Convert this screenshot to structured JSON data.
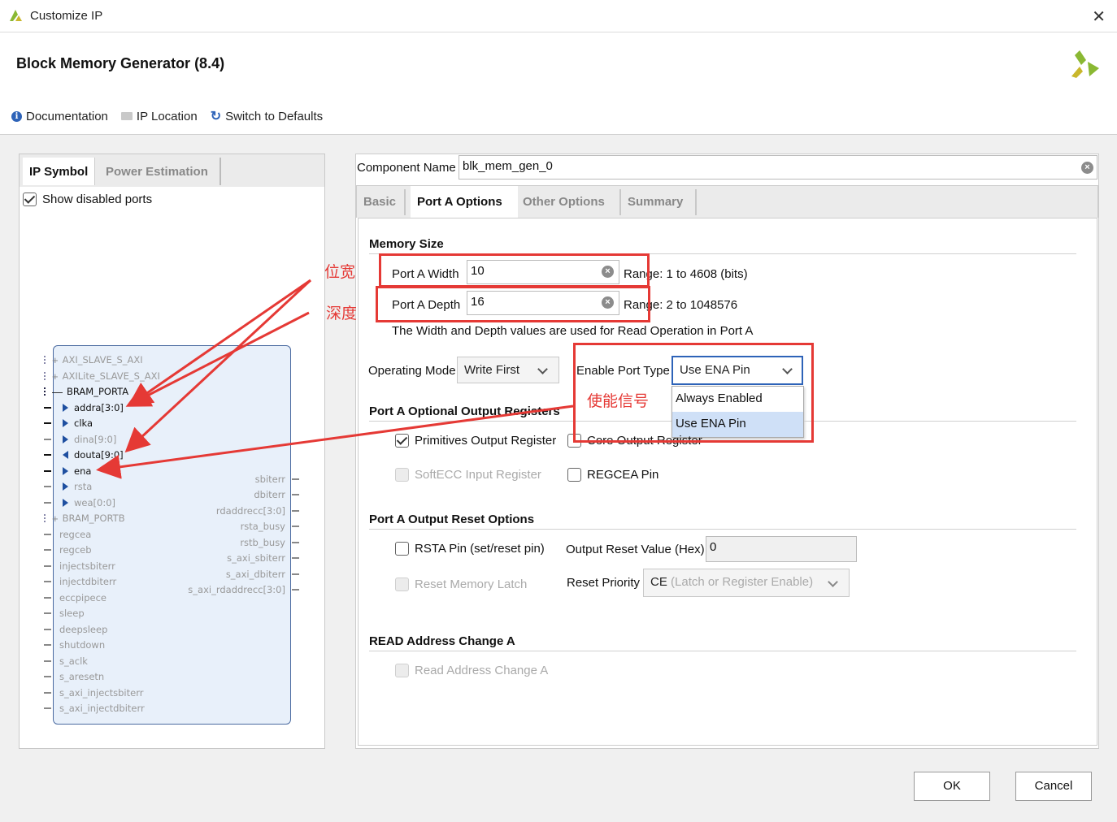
{
  "window": {
    "title": "Customize IP",
    "close": "✕"
  },
  "header": {
    "title": "Block Memory Generator (8.4)"
  },
  "toolbar": {
    "documentation": "Documentation",
    "ip_location": "IP Location",
    "switch_defaults": "Switch to Defaults"
  },
  "left": {
    "tabs": [
      "IP Symbol",
      "Power Estimation"
    ],
    "show_disabled_ports": "Show disabled ports",
    "show_disabled_checked": true,
    "ports_left": [
      {
        "name": "AXI_SLAVE_S_AXI",
        "active": false
      },
      {
        "name": "AXILite_SLAVE_S_AXI",
        "active": false
      },
      {
        "name": "BRAM_PORTA",
        "active": true
      },
      {
        "name": "addra[3:0]",
        "active": true
      },
      {
        "name": "clka",
        "active": true
      },
      {
        "name": "dina[9:0]",
        "active": false
      },
      {
        "name": "douta[9:0]",
        "active": true
      },
      {
        "name": "ena",
        "active": true
      },
      {
        "name": "rsta",
        "active": false
      },
      {
        "name": "wea[0:0]",
        "active": false
      },
      {
        "name": "BRAM_PORTB",
        "active": false
      },
      {
        "name": "regcea",
        "active": false
      },
      {
        "name": "regceb",
        "active": false
      },
      {
        "name": "injectsbiterr",
        "active": false
      },
      {
        "name": "injectdbiterr",
        "active": false
      },
      {
        "name": "eccpipece",
        "active": false
      },
      {
        "name": "sleep",
        "active": false
      },
      {
        "name": "deepsleep",
        "active": false
      },
      {
        "name": "shutdown",
        "active": false
      },
      {
        "name": "s_aclk",
        "active": false
      },
      {
        "name": "s_aresetn",
        "active": false
      },
      {
        "name": "s_axi_injectsbiterr",
        "active": false
      },
      {
        "name": "s_axi_injectdbiterr",
        "active": false
      }
    ],
    "ports_right": [
      "sbiterr",
      "dbiterr",
      "rdaddrecc[3:0]",
      "rsta_busy",
      "rstb_busy",
      "s_axi_sbiterr",
      "s_axi_dbiterr",
      "s_axi_rdaddrecc[3:0]"
    ]
  },
  "right": {
    "component_name_label": "Component Name",
    "component_name": "blk_mem_gen_0",
    "tabs": [
      "Basic",
      "Port A Options",
      "Other Options",
      "Summary"
    ],
    "active_tab": "Port A Options",
    "memory_size": {
      "header": "Memory Size",
      "width_label": "Port A Width",
      "width_value": "10",
      "width_range": "Range: 1 to 4608 (bits)",
      "depth_label": "Port A Depth",
      "depth_value": "16",
      "depth_range": "Range: 2 to 1048576",
      "note": "The Width and Depth values are used for Read Operation in Port A"
    },
    "operating_mode_label": "Operating Mode",
    "operating_mode": "Write First",
    "enable_port_type_label": "Enable Port Type",
    "enable_port_type": "Use ENA Pin",
    "enable_options": [
      "Always Enabled",
      "Use ENA Pin"
    ],
    "optional_regs": {
      "header": "Port A Optional Output Registers",
      "primitives": "Primitives Output Register",
      "core": "Core Output Register",
      "softecc": "SoftECC Input Register",
      "regcea": "REGCEA Pin"
    },
    "reset": {
      "header": "Port A Output Reset Options",
      "rsta": "RSTA Pin (set/reset pin)",
      "output_reset_label": "Output Reset Value (Hex)",
      "output_reset_value": "0",
      "reset_latch": "Reset Memory Latch",
      "priority_label": "Reset Priority",
      "priority_value_ce": "CE",
      "priority_value_rest": "(Latch or Register Enable)"
    },
    "read_addr": {
      "header": "READ Address Change A",
      "option": "Read Address Change A"
    }
  },
  "annotations": {
    "width": "位宽",
    "depth": "深度",
    "enable": "使能信号"
  },
  "buttons": {
    "ok": "OK",
    "cancel": "Cancel"
  },
  "colors": {
    "annotation_red": "#e53935",
    "accent_blue": "#2e63b8",
    "xilinx_green": "#8ab833"
  }
}
